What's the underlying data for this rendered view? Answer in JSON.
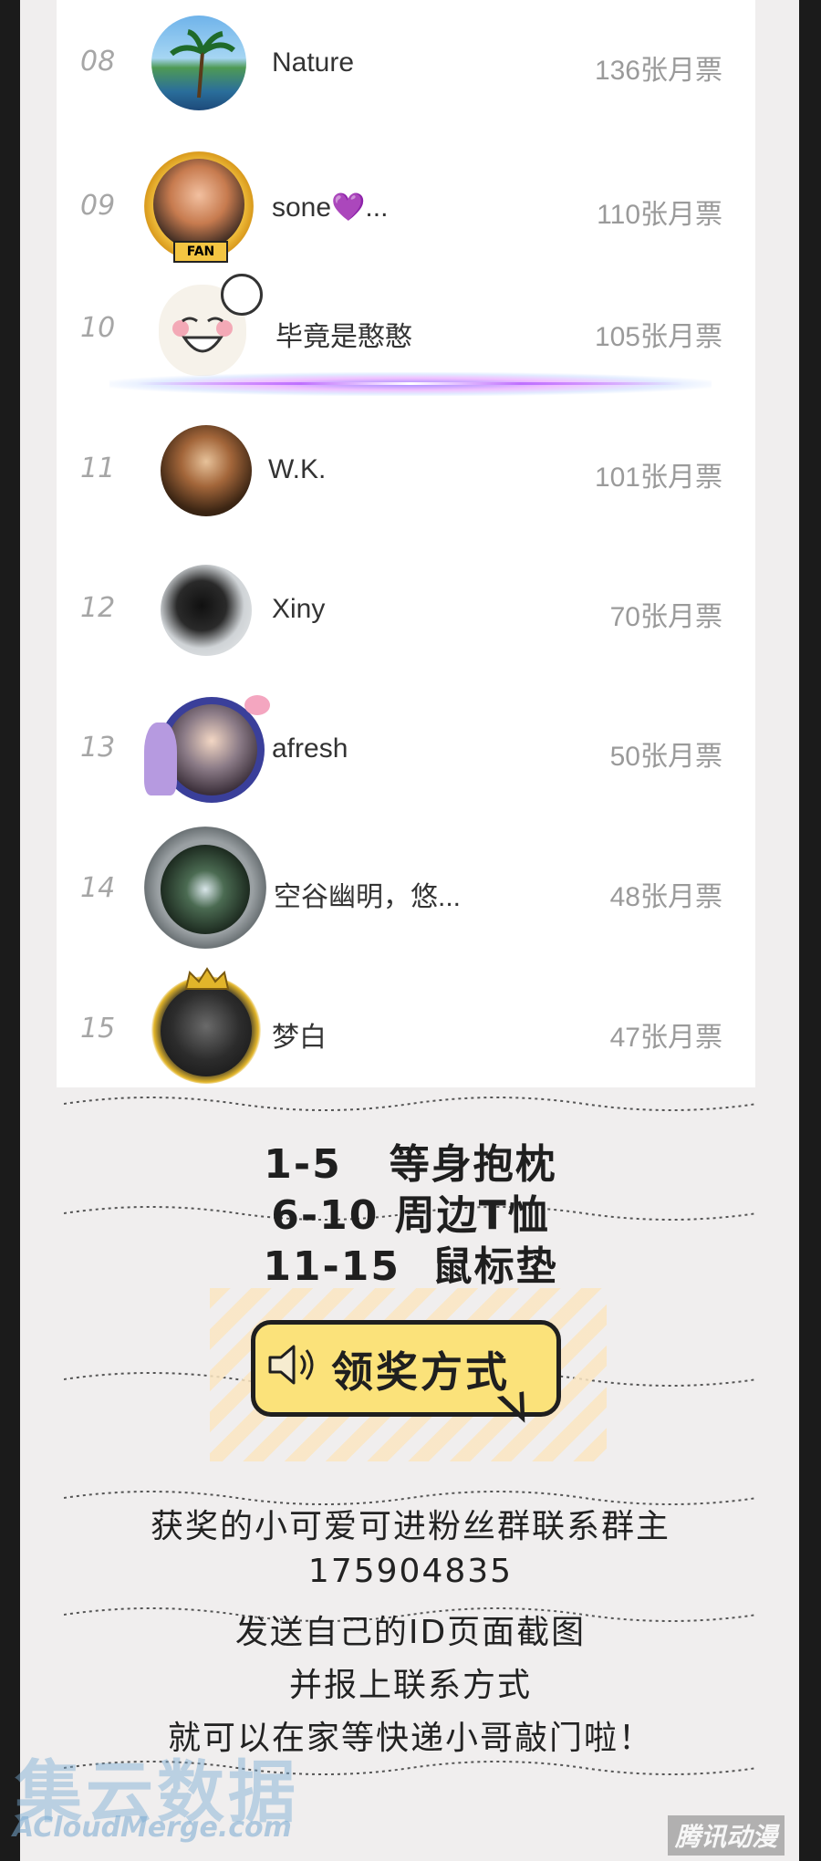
{
  "ranking": [
    {
      "rank": "08",
      "name": "Nature",
      "votes": "136张月票",
      "avatar": "palm-beach-avatar"
    },
    {
      "rank": "09",
      "name": "sone💜...",
      "votes": "110张月票",
      "avatar": "fan-badge-avatar"
    },
    {
      "rank": "10",
      "name": "毕竟是憨憨",
      "votes": "105张月票",
      "avatar": "meme-face-avatar"
    },
    {
      "rank": "11",
      "name": "W.K.",
      "votes": "101张月票",
      "avatar": "portrait-avatar"
    },
    {
      "rank": "12",
      "name": "Xiny",
      "votes": "70张月票",
      "avatar": "black-cat-avatar"
    },
    {
      "rank": "13",
      "name": "afresh",
      "votes": "50张月票",
      "avatar": "anime-avatar"
    },
    {
      "rank": "14",
      "name": "空谷幽明，悠...",
      "votes": "48张月票",
      "avatar": "waterfall-avatar"
    },
    {
      "rank": "15",
      "name": "梦白",
      "votes": "47张月票",
      "avatar": "crown-frame-avatar"
    }
  ],
  "prizes": {
    "line1": "1-5   等身抱枕",
    "line2": "6-10 周边T恤",
    "line3": "11-15  鼠标垫"
  },
  "claim": {
    "title": "领奖方式",
    "icon": "speaker-icon",
    "lines": [
      "获奖的小可爱可进粉丝群联系群主",
      "175904835",
      "发送自己的ID页面截图",
      "并报上联系方式",
      "就可以在家等快递小哥敲门啦！"
    ]
  },
  "watermarks": {
    "cn": "集云数据",
    "en": "ACloudMerge.com",
    "corner": "腾讯动漫"
  },
  "colors": {
    "bubble": "#fbe27a",
    "stripe": "#fbe6c1",
    "background": "#f0eeee"
  }
}
